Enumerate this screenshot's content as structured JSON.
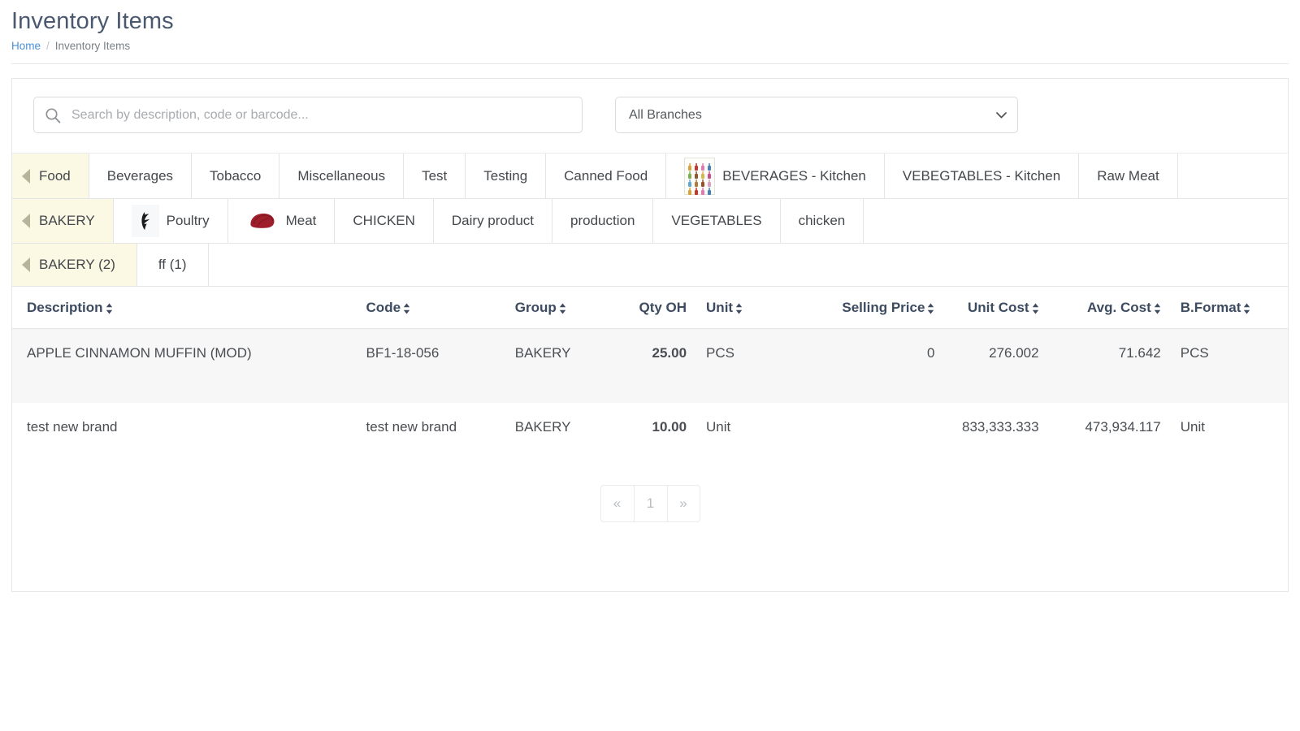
{
  "page": {
    "title": "Inventory Items",
    "breadcrumb": {
      "home": "Home",
      "separator": "/",
      "current": "Inventory Items"
    }
  },
  "filters": {
    "search": {
      "placeholder": "Search by description, code or barcode...",
      "value": "",
      "icon": "search-icon"
    },
    "branch": {
      "selected": "All Branches",
      "options": [
        "All Branches"
      ],
      "icon": "chevron-down-icon"
    }
  },
  "tabs_level1": [
    {
      "label": "Food",
      "active": true,
      "icon": null
    },
    {
      "label": "Beverages",
      "active": false,
      "icon": null
    },
    {
      "label": "Tobacco",
      "active": false,
      "icon": null
    },
    {
      "label": "Miscellaneous",
      "active": false,
      "icon": null
    },
    {
      "label": "Test",
      "active": false,
      "icon": null
    },
    {
      "label": "Testing",
      "active": false,
      "icon": null
    },
    {
      "label": "Canned Food",
      "active": false,
      "icon": null
    },
    {
      "label": "BEVERAGES - Kitchen",
      "active": false,
      "icon": "beverages-thumbnail-icon"
    },
    {
      "label": "VEBEGTABLES - Kitchen",
      "active": false,
      "icon": null
    },
    {
      "label": "Raw Meat",
      "active": false,
      "icon": null
    }
  ],
  "tabs_level2": [
    {
      "label": "BAKERY",
      "active": true,
      "icon": null
    },
    {
      "label": "Poultry",
      "active": false,
      "icon": "poultry-thumbnail-icon"
    },
    {
      "label": "Meat",
      "active": false,
      "icon": "meat-thumbnail-icon"
    },
    {
      "label": "CHICKEN",
      "active": false,
      "icon": null
    },
    {
      "label": "Dairy product",
      "active": false,
      "icon": null
    },
    {
      "label": "production",
      "active": false,
      "icon": null
    },
    {
      "label": "VEGETABLES",
      "active": false,
      "icon": null
    },
    {
      "label": "chicken",
      "active": false,
      "icon": null
    }
  ],
  "tabs_level3": [
    {
      "label": "BAKERY (2)",
      "active": true,
      "icon": null
    },
    {
      "label": "ff (1)",
      "active": false,
      "icon": null
    }
  ],
  "table": {
    "columns": [
      {
        "label": "Description",
        "sortable": true,
        "align": "left"
      },
      {
        "label": "Code",
        "sortable": true,
        "align": "left"
      },
      {
        "label": "Group",
        "sortable": true,
        "align": "left"
      },
      {
        "label": "Qty OH",
        "sortable": false,
        "align": "right"
      },
      {
        "label": "Unit",
        "sortable": true,
        "align": "left"
      },
      {
        "label": "Selling Price",
        "sortable": true,
        "align": "right"
      },
      {
        "label": "Unit Cost",
        "sortable": true,
        "align": "right"
      },
      {
        "label": "Avg. Cost",
        "sortable": true,
        "align": "right"
      },
      {
        "label": "B.Format",
        "sortable": true,
        "align": "left"
      }
    ],
    "rows": [
      {
        "description": "APPLE CINNAMON MUFFIN (MOD)",
        "code": "BF1-18-056",
        "group": "BAKERY",
        "qty_oh": "25.00",
        "unit": "PCS",
        "selling_price": "0",
        "unit_cost": "276.002",
        "avg_cost": "71.642",
        "b_format": "PCS"
      },
      {
        "description": "test new brand",
        "code": "test new brand",
        "group": "BAKERY",
        "qty_oh": "10.00",
        "unit": "Unit",
        "selling_price": "",
        "unit_cost": "833,333.333",
        "avg_cost": "473,934.117",
        "b_format": "Unit"
      }
    ]
  },
  "pagination": {
    "prev": "«",
    "pages": [
      "1"
    ],
    "next": "»"
  },
  "colors": {
    "title": "#4a5870",
    "link": "#4a90d9",
    "active_tab_bg": "#fbf8e3",
    "qty_value": "#1712e8",
    "header_text": "#3d4b60"
  }
}
